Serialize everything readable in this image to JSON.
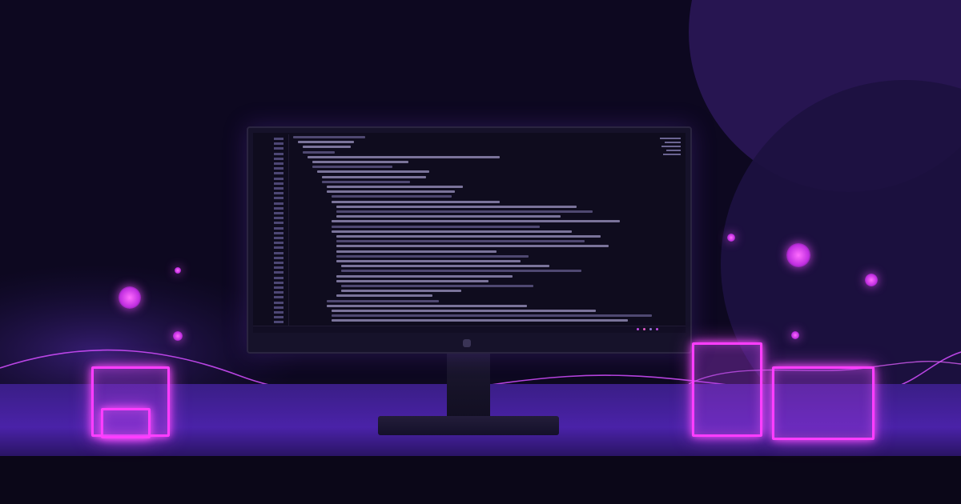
{
  "scene": {
    "description_colors": {
      "background": "#0d0820",
      "accent": "#ff3dff",
      "floor": "#4a22a8"
    },
    "icons": [
      "monitor-icon",
      "neon-cube-icon",
      "glowing-orb-icon"
    ]
  }
}
